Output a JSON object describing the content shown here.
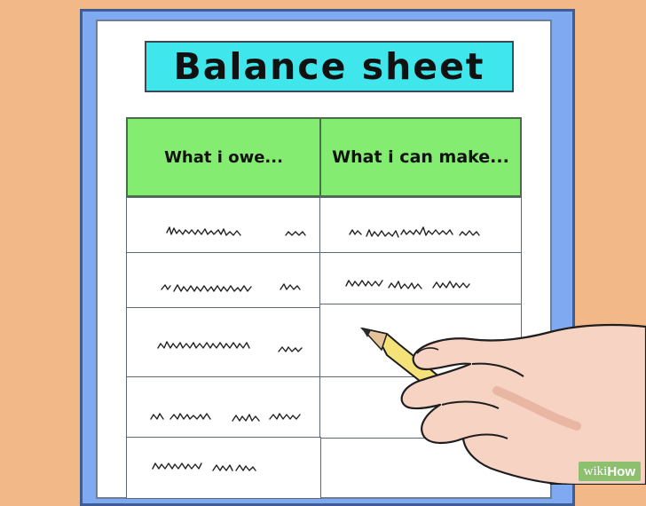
{
  "title": "Balance sheet",
  "columns": [
    "What i owe...",
    "What i can make..."
  ],
  "watermark": {
    "prefix": "wiki",
    "suffix": "How"
  },
  "colors": {
    "background": "#f3b887",
    "clipboard": "#7fa9f1",
    "title_fill": "#3fe6ec",
    "header_fill": "#84ec70"
  }
}
